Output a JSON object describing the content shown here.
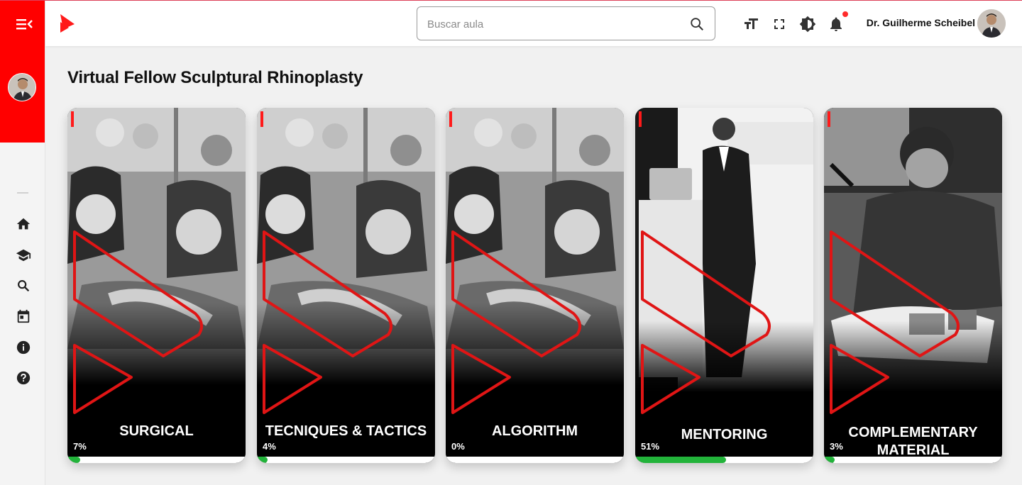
{
  "header": {
    "search_placeholder": "Buscar aula",
    "user_name": "Dr. Guilherme Scheibel",
    "has_notification": true,
    "icons": [
      "text-size-icon",
      "fullscreen-icon",
      "brightness-icon",
      "bell-icon",
      "search-icon"
    ]
  },
  "sidebar": {
    "items": [
      {
        "icon": "home-icon"
      },
      {
        "icon": "courses-icon"
      },
      {
        "icon": "search-icon"
      },
      {
        "icon": "calendar-icon"
      },
      {
        "icon": "info-icon"
      },
      {
        "icon": "help-icon"
      }
    ]
  },
  "main": {
    "title": "Virtual Fellow Sculptural Rhinoplasty",
    "cards": [
      {
        "title": "SURGICAL",
        "progress_label": "7%",
        "progress": 0.07
      },
      {
        "title": "TECNIQUES & TACTICS",
        "progress_label": "4%",
        "progress": 0.04
      },
      {
        "title": "ALGORITHM",
        "progress_label": "0%",
        "progress": 0.0
      },
      {
        "title": "MENTORING",
        "progress_label": "51%",
        "progress": 0.51
      },
      {
        "title": "COMPLEMENTARY MATERIAL",
        "progress_label": "3%",
        "progress": 0.03
      }
    ]
  },
  "colors": {
    "brand_red": "#ff0000",
    "progress_green": "#22b33a",
    "notification_dot": "#ff2b2b"
  }
}
